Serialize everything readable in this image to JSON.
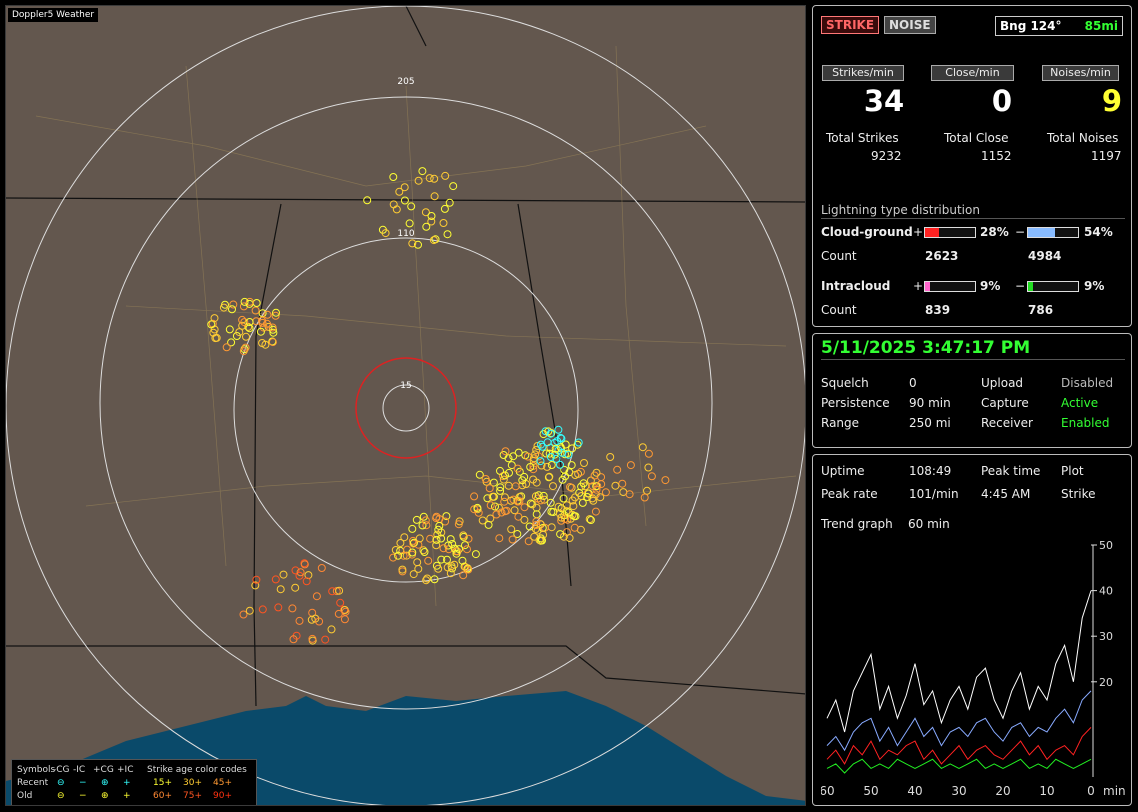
{
  "map": {
    "title": "Doppler5 Weather",
    "ring_labels": [
      "205",
      "110",
      "15"
    ]
  },
  "legend": {
    "symbols_label": "Symbols",
    "col_labels": [
      "-CG",
      "-IC",
      "+CG",
      "+IC"
    ],
    "age_label": "Strike age color codes",
    "recent_label": "Recent",
    "old_label": "Old",
    "recent_symbols": [
      "⊖",
      "−",
      "⊕",
      "+"
    ],
    "old_symbols": [
      "⊖",
      "−",
      "⊕",
      "+"
    ],
    "recent_ages": [
      "15+",
      "30+",
      "45+"
    ],
    "old_ages": [
      "60+",
      "75+",
      "90+"
    ],
    "colors": {
      "recent_symbol": "#33ffff",
      "old_symbol": "#ffff33",
      "age15": "#ffff33",
      "age30": "#ffcc33",
      "age45": "#ff9933",
      "age60": "#ff8833",
      "age75": "#ff5522",
      "age90": "#ff3311"
    }
  },
  "panel1": {
    "strike_btn": "STRIKE",
    "noise_btn": "NOISE",
    "bearing": "Bng 124°",
    "distance": "85mi",
    "headers": [
      "Strikes/min",
      "Close/min",
      "Noises/min"
    ],
    "big_values": [
      "34",
      "0",
      "9"
    ],
    "big_colors": [
      "#ffffff",
      "#ffffff",
      "#ffff33"
    ],
    "total_labels": [
      "Total Strikes",
      "Total Close",
      "Total Noises"
    ],
    "total_values": [
      "9232",
      "1152",
      "1197"
    ],
    "dist_title": "Lightning type distribution",
    "cg_label": "Cloud-ground",
    "ic_label": "Intracloud",
    "count_label": "Count",
    "plus": "+",
    "minus": "−",
    "cg_pos_pct": "28%",
    "cg_neg_pct": "54%",
    "ic_pos_pct": "9%",
    "ic_neg_pct": "9%",
    "cg_pos_count": "2623",
    "cg_neg_count": "4984",
    "ic_pos_count": "839",
    "ic_neg_count": "786",
    "cg_pos_frac": 0.28,
    "cg_neg_frac": 0.54,
    "ic_pos_frac": 0.09,
    "ic_neg_frac": 0.09
  },
  "panel2": {
    "datetime": "5/11/2025 3:47:17 PM",
    "rows": [
      {
        "k1": "Squelch",
        "v1": "0",
        "k2": "Upload",
        "v2": "Disabled",
        "v2color": "#bbbbbb"
      },
      {
        "k1": "Persistence",
        "v1": "90 min",
        "k2": "Capture",
        "v2": "Active",
        "v2color": "#33ff33"
      },
      {
        "k1": "Range",
        "v1": "250 mi",
        "k2": "Receiver",
        "v2": "Enabled",
        "v2color": "#33ff33"
      }
    ]
  },
  "panel3": {
    "uptime_label": "Uptime",
    "uptime": "108:49",
    "peak_time_label": "Peak time",
    "plot_label": "Plot",
    "peak_rate_label": "Peak rate",
    "peak_rate": "101/min",
    "peak_time": "4:45 AM",
    "plot_value": "Strike",
    "trend_label": "Trend graph",
    "trend_value": "60 min",
    "x_unit": "min"
  },
  "chart_data": {
    "type": "line",
    "x": [
      60,
      58,
      56,
      54,
      52,
      50,
      48,
      46,
      44,
      42,
      40,
      38,
      36,
      34,
      32,
      30,
      28,
      26,
      24,
      22,
      20,
      18,
      16,
      14,
      12,
      10,
      8,
      6,
      4,
      2,
      0
    ],
    "x_ticks": [
      "60",
      "50",
      "40",
      "30",
      "20",
      "10",
      "0"
    ],
    "y_ticks": [
      "50",
      "40",
      "30",
      "20"
    ],
    "ylim": [
      0,
      50
    ],
    "xlim": [
      60,
      0
    ],
    "xlabel": "min",
    "series": [
      {
        "color": "#ffffff",
        "values": [
          12,
          16,
          9,
          18,
          22,
          26,
          14,
          19,
          12,
          17,
          24,
          15,
          18,
          11,
          16,
          19,
          14,
          21,
          23,
          16,
          12,
          18,
          22,
          14,
          19,
          16,
          24,
          28,
          20,
          34,
          40
        ]
      },
      {
        "color": "#88aaff",
        "values": [
          6,
          8,
          5,
          9,
          11,
          12,
          7,
          10,
          6,
          9,
          12,
          8,
          10,
          6,
          9,
          10,
          8,
          11,
          12,
          9,
          7,
          10,
          11,
          8,
          10,
          9,
          12,
          14,
          11,
          16,
          18
        ]
      },
      {
        "color": "#ff2222",
        "values": [
          3,
          5,
          2,
          6,
          4,
          7,
          3,
          5,
          4,
          6,
          7,
          3,
          5,
          2,
          4,
          6,
          3,
          5,
          6,
          4,
          3,
          5,
          7,
          4,
          6,
          3,
          5,
          6,
          4,
          8,
          10
        ]
      },
      {
        "color": "#22ee22",
        "values": [
          1,
          2,
          0,
          2,
          3,
          1,
          2,
          1,
          3,
          2,
          1,
          2,
          3,
          1,
          2,
          1,
          2,
          3,
          1,
          2,
          1,
          2,
          3,
          1,
          2,
          1,
          3,
          2,
          1,
          2,
          3
        ]
      }
    ]
  }
}
